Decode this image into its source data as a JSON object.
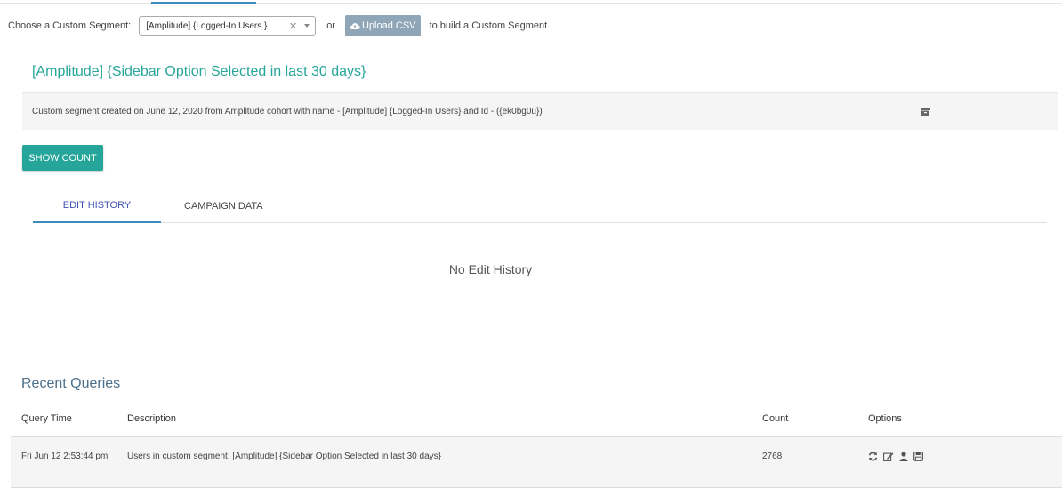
{
  "chooser": {
    "label": "Choose a Custom Segment:",
    "selected": "[Amplitude] {Logged-In Users }",
    "clear_glyph": "✕",
    "or_text": "or",
    "upload_label": "Upload CSV",
    "tail_text": "to build a Custom Segment"
  },
  "segment": {
    "title": "[Amplitude] {Sidebar Option Selected in last 30 days}",
    "info": "Custom segment created on June 12, 2020 from Amplitude cohort with name - [Amplitude] {Logged-In Users} and Id - ({ek0bg0u})"
  },
  "show_count_label": "Show Count",
  "tabs": [
    {
      "label": "EDIT HISTORY",
      "active": true
    },
    {
      "label": "CAMPAIGN DATA",
      "active": false
    }
  ],
  "empty_state": "No Edit History",
  "recent": {
    "title": "Recent Queries",
    "headers": [
      "Query Time",
      "Description",
      "Count",
      "Options"
    ],
    "rows": [
      {
        "time": "Fri Jun 12 2:53:44 pm",
        "description": "Users in custom segment: [Amplitude] {Sidebar Option Selected in last 30 days}",
        "count": "2768",
        "option_icons": [
          "refresh-icon",
          "edit-icon",
          "user-icon",
          "save-icon"
        ]
      }
    ]
  },
  "colors": {
    "accent_teal": "#26a69a",
    "upload_button": "#8fa6b8",
    "active_tab_text": "#3f51b5",
    "active_tab_line": "#3c8dbc",
    "recent_title": "#4a6f8a"
  }
}
